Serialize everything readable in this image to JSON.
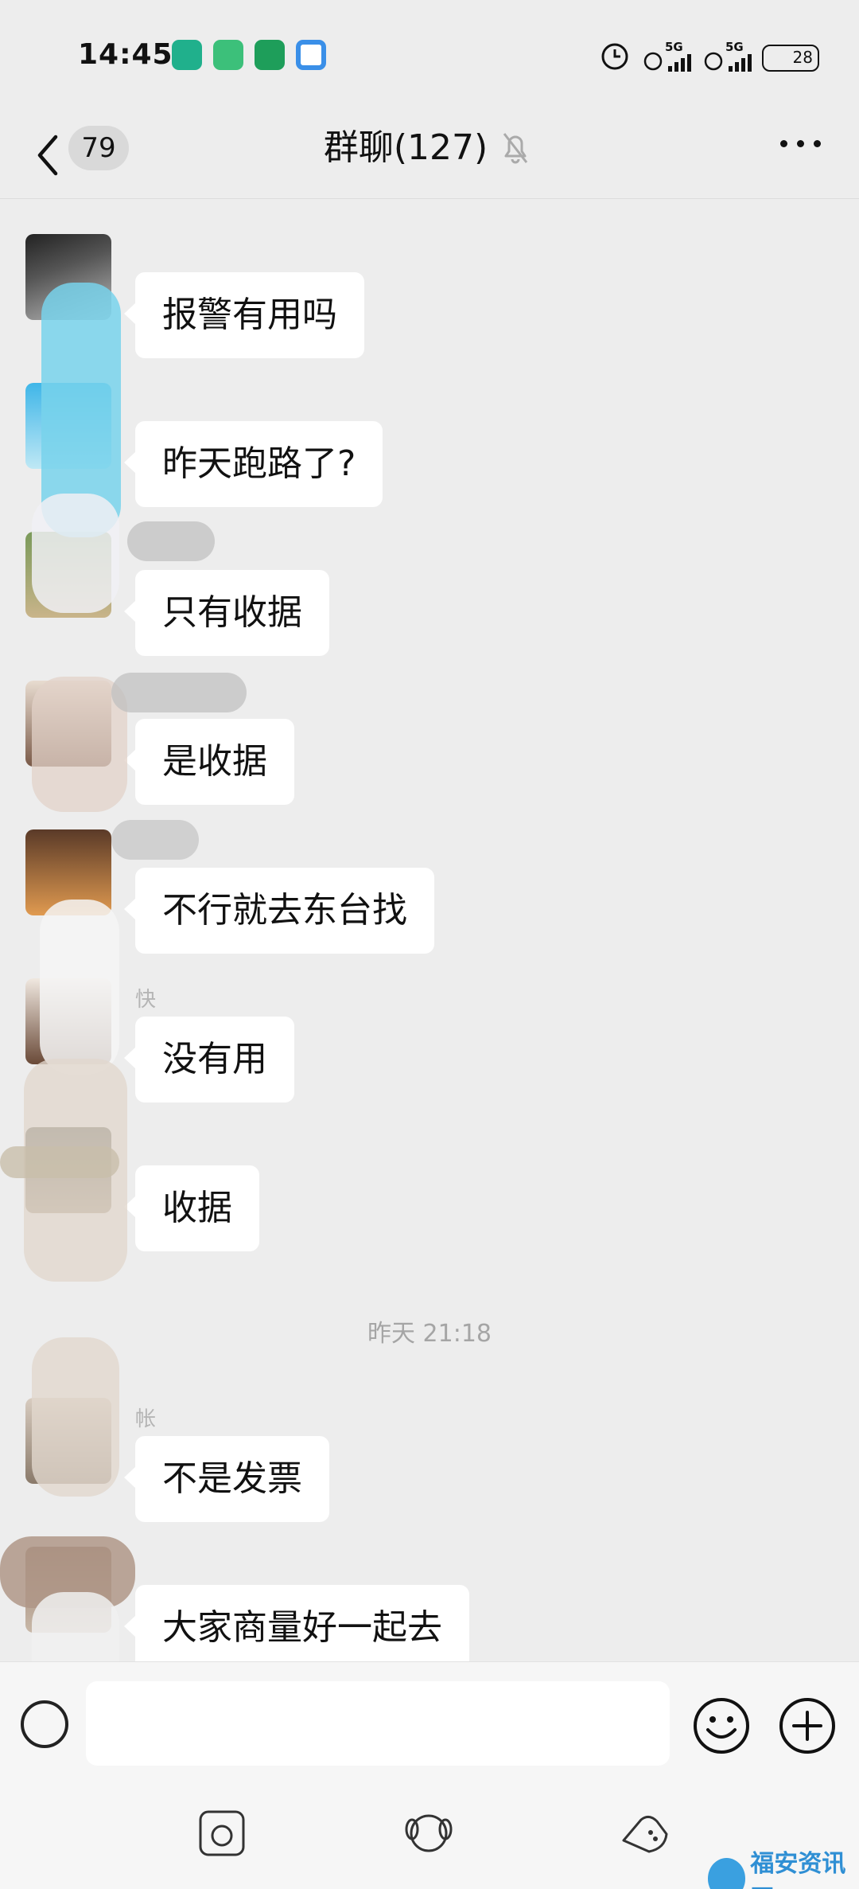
{
  "status_bar": {
    "time": "14:45",
    "network_1": "5G",
    "network_2": "5G",
    "battery": "28"
  },
  "header": {
    "unread_count": "79",
    "title": "群聊(127)"
  },
  "messages": [
    {
      "sender": "",
      "text": "报警有用吗"
    },
    {
      "sender": "",
      "text": "昨天跑路了?"
    },
    {
      "sender": "",
      "text": "只有收据"
    },
    {
      "sender": "",
      "text": "是收据"
    },
    {
      "sender": "",
      "text": "不行就去东台找"
    },
    {
      "sender": "快",
      "text": "没有用"
    },
    {
      "sender": "",
      "text": "收据"
    },
    {
      "sender": "帐",
      "text": "不是发票"
    },
    {
      "sender": "",
      "text": "大家商量好一起去"
    }
  ],
  "timestamp": "昨天 21:18",
  "input": {
    "placeholder": ""
  },
  "watermark": "福安资讯网",
  "colors": {
    "background": "#ededed",
    "bubble": "#ffffff",
    "accent_watermark": "#2f8fd4"
  }
}
